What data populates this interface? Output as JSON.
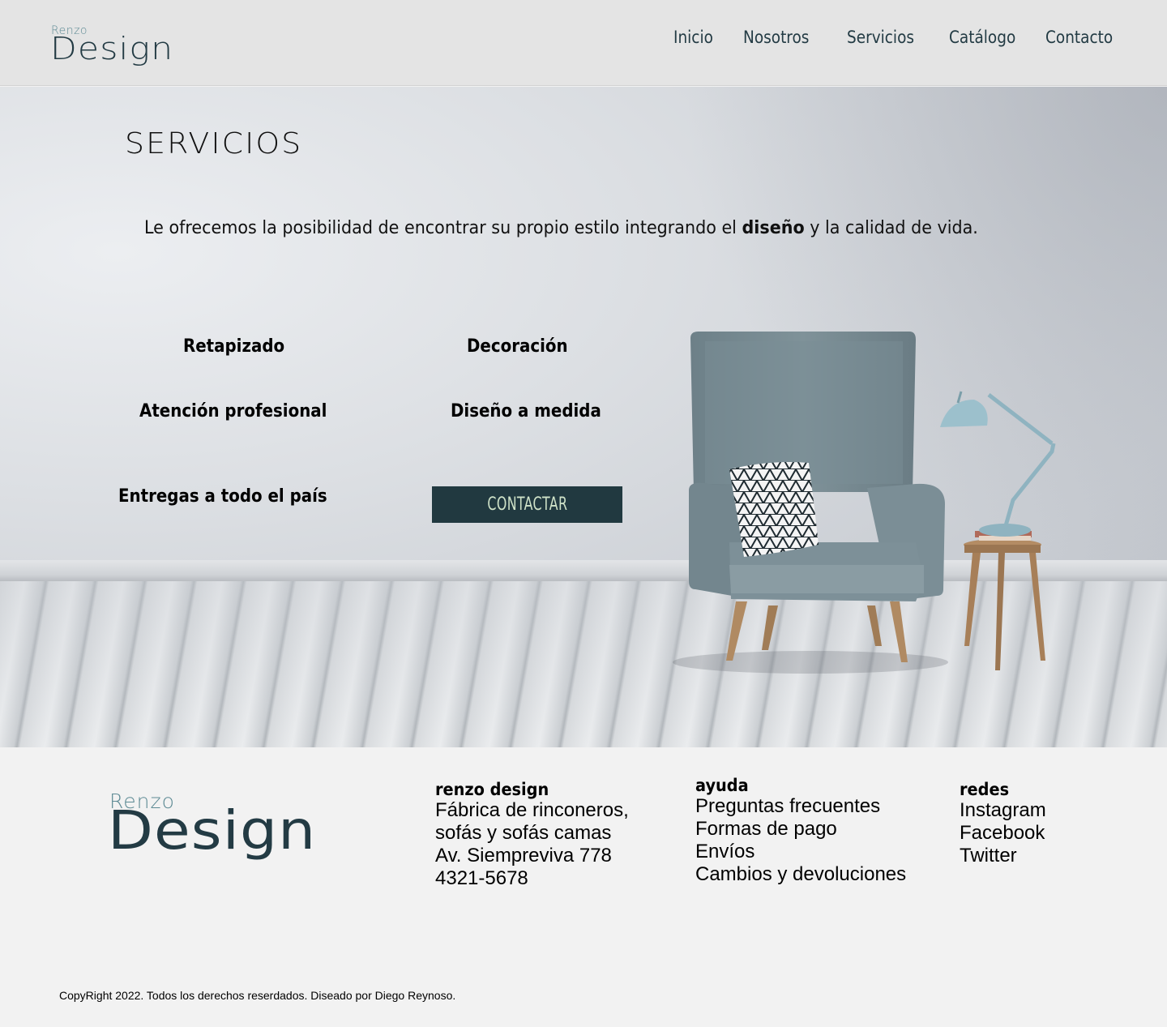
{
  "header": {
    "logo": {
      "small": "Renzo",
      "big": "Design"
    },
    "nav": [
      {
        "label": "Inicio"
      },
      {
        "label": "Nosotros"
      },
      {
        "label": "Servicios"
      },
      {
        "label": "Catálogo"
      },
      {
        "label": "Contacto"
      }
    ]
  },
  "hero": {
    "title": "SERVICIOS",
    "text_before": "Le ofrecemos la posibilidad de encontrar su propio estilo integrando el ",
    "text_bold": "diseño",
    "text_after": " y la calidad de vida.",
    "services": [
      "Retapizado",
      "Decoración",
      "Atención profesional",
      "Diseño a medida",
      "Entregas a todo el país"
    ],
    "cta_label": "CONTACTAR"
  },
  "footer": {
    "logo": {
      "small": "Renzo",
      "big": "Design"
    },
    "company": {
      "heading": "renzo design",
      "lines": [
        "Fábrica de rinconeros,",
        "sofás y sofás camas",
        "Av. Siempreviva 778",
        "4321-5678"
      ]
    },
    "help": {
      "heading": "ayuda",
      "links": [
        "Preguntas frecuentes",
        "Formas de pago",
        "Envíos",
        "Cambios y devoluciones"
      ]
    },
    "social": {
      "heading": "redes",
      "links": [
        "Instagram",
        "Facebook",
        "Twitter"
      ]
    },
    "copyright": "CopyRight 2022. Todos los derechos reserdados. Diseado por Diego Reynoso."
  },
  "colors": {
    "brand_dark": "#233b44",
    "brand_light": "#5d8a94",
    "cta_bg": "#213940",
    "cta_text": "#cfe2c8"
  }
}
